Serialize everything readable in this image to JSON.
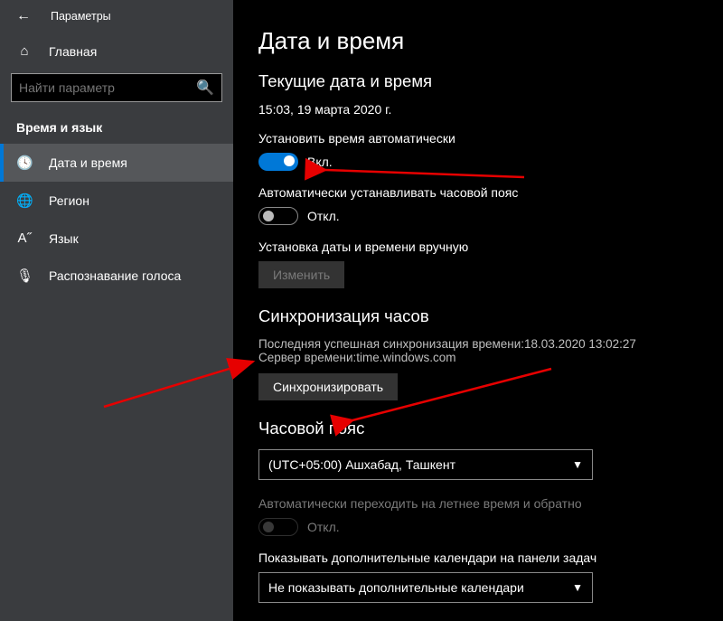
{
  "window_title": "Параметры",
  "home_label": "Главная",
  "search_placeholder": "Найти параметр",
  "group_title": "Время и язык",
  "sidebar_items": [
    {
      "name": "date-time",
      "label": "Дата и время",
      "icon": "🕓",
      "selected": true
    },
    {
      "name": "region",
      "label": "Регион",
      "icon": "🌐",
      "selected": false
    },
    {
      "name": "language",
      "label": "Язык",
      "icon": "A˝",
      "selected": false
    },
    {
      "name": "speech",
      "label": "Распознавание голоса",
      "icon": "🎙",
      "selected": false
    }
  ],
  "page_title": "Дата и время",
  "current_title": "Текущие дата и время",
  "current_value": "15:03, 19 марта 2020 г.",
  "auto_time": {
    "label": "Установить время автоматически",
    "state_text": "Вкл.",
    "on": true
  },
  "auto_tz": {
    "label": "Автоматически устанавливать часовой пояс",
    "state_text": "Откл.",
    "on": false
  },
  "manual": {
    "label": "Установка даты и времени вручную",
    "button": "Изменить",
    "enabled": false
  },
  "sync": {
    "title": "Синхронизация часов",
    "last_sync_line": "Последняя успешная синхронизация времени:18.03.2020 13:02:27",
    "server_line": "Сервер времени:time.windows.com",
    "button": "Синхронизировать"
  },
  "tz": {
    "title": "Часовой пояс",
    "value": "(UTC+05:00) Ашхабад, Ташкент"
  },
  "dst": {
    "label": "Автоматически переходить на летнее время и обратно",
    "state_text": "Откл.",
    "on": false,
    "enabled": false
  },
  "extra_cal": {
    "label": "Показывать дополнительные календари на панели задач",
    "value": "Не показывать дополнительные календари"
  },
  "colors": {
    "accent": "#0078d7",
    "arrow": "#e60000"
  }
}
